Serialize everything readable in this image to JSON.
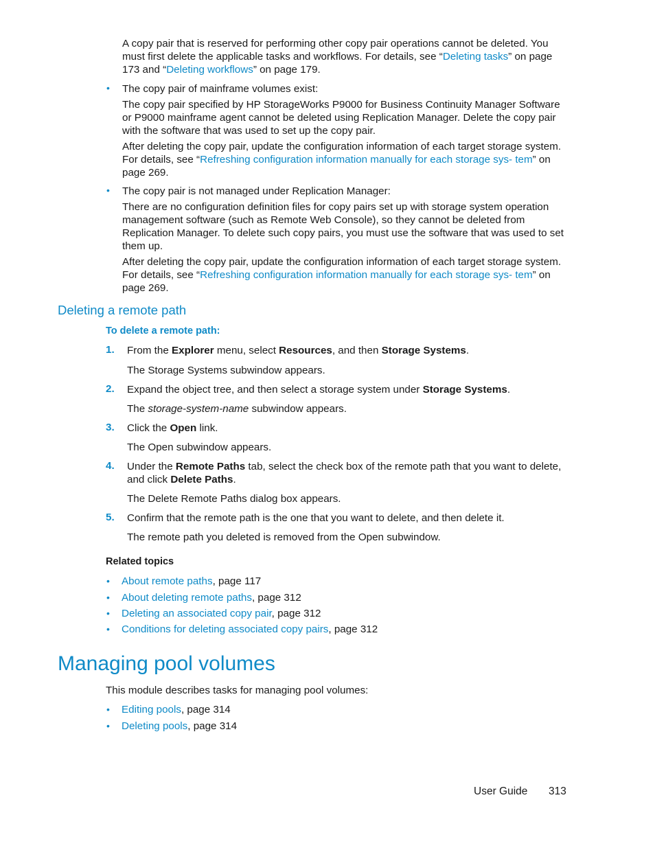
{
  "intro": {
    "para1": {
      "t1": "A copy pair that is reserved for performing other copy pair operations cannot be deleted. You must first delete the applicable tasks and workflows. For details, see “",
      "link1": "Deleting tasks",
      "t2": "” on page 173 and “",
      "link2": "Deleting workflows",
      "t3": "” on page 179."
    },
    "bullet_mainframe": {
      "title": "The copy pair of mainframe volumes exist:",
      "para1": "The copy pair specified by HP StorageWorks P9000 for Business Continuity Manager Software or P9000 mainframe agent cannot be deleted using Replication Manager. Delete the copy pair with the software that was used to set up the copy pair.",
      "para2_t1": "After deleting the copy pair, update the configuration information of each target storage system. For details, see “",
      "para2_link": "Refreshing configuration information manually for each storage sys- tem",
      "para2_t2": "” on page 269."
    },
    "bullet_unmanaged": {
      "title": "The copy pair is not managed under Replication Manager:",
      "para1": "There are no configuration definition files for copy pairs set up with storage system operation management software (such as Remote Web Console), so they cannot be deleted from Replication Manager. To delete such copy pairs, you must use the software that was used to set them up.",
      "para2_t1": "After deleting the copy pair, update the configuration information of each target storage system. For details, see “",
      "para2_link": "Refreshing configuration information manually for each storage sys- tem",
      "para2_t2": "” on page 269."
    }
  },
  "section_remote_path": {
    "heading": "Deleting a remote path",
    "procedure_title": "To delete a remote path:",
    "steps": [
      {
        "num": "1.",
        "a": "From the ",
        "b1": "Explorer",
        "c": " menu, select ",
        "b2": "Resources",
        "d": ", and then ",
        "b3": "Storage Systems",
        "e": ".",
        "result": "The Storage Systems subwindow appears."
      },
      {
        "num": "2.",
        "a": "Expand the object tree, and then select a storage system under ",
        "b1": "Storage Systems",
        "e": ".",
        "result_a": "The ",
        "result_i": "storage-system-name",
        "result_b": " subwindow appears."
      },
      {
        "num": "3.",
        "a": "Click the ",
        "b1": "Open",
        "e": " link.",
        "result": "The Open subwindow appears."
      },
      {
        "num": "4.",
        "a": "Under the ",
        "b1": "Remote Paths",
        "c": " tab, select the check box of the remote path that you want to delete, and click ",
        "b2": "Delete Paths",
        "e": ".",
        "result": "The Delete Remote Paths dialog box appears."
      },
      {
        "num": "5.",
        "a": "Confirm that the remote path is the one that you want to delete, and then delete it.",
        "result": "The remote path you deleted is removed from the Open subwindow."
      }
    ],
    "related_title": "Related topics",
    "related": [
      {
        "link": "About remote paths",
        "page": ", page 117"
      },
      {
        "link": "About deleting remote paths",
        "page": ", page 312"
      },
      {
        "link": "Deleting an associated copy pair",
        "page": ", page 312"
      },
      {
        "link": "Conditions for deleting associated copy pairs",
        "page": ", page 312"
      }
    ]
  },
  "section_pool": {
    "heading": "Managing pool volumes",
    "intro": "This module describes tasks for managing pool volumes:",
    "items": [
      {
        "link": "Editing pools",
        "page": ", page 314"
      },
      {
        "link": "Deleting pools",
        "page": ", page 314"
      }
    ]
  },
  "footer": {
    "label": "User Guide",
    "page_number": "313"
  },
  "bullet_char": "•"
}
